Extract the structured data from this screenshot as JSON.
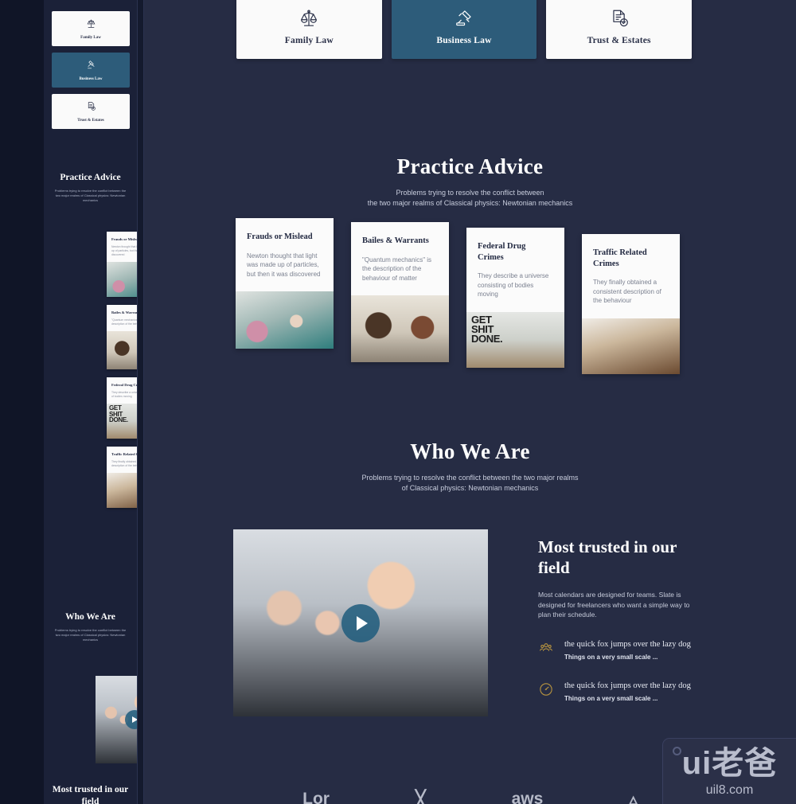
{
  "theme": {
    "background": "#262c44",
    "sidebar_background": "#1b2138",
    "gutter_background": "#101527",
    "accent_teal": "#2d5c7a",
    "card_background": "#fafafa",
    "icon_gold": "#b9953f"
  },
  "tabs": [
    {
      "label": "Family Law",
      "icon": "scales-of-justice-icon",
      "active": false
    },
    {
      "label": "Business Law",
      "icon": "gavel-icon",
      "active": true
    },
    {
      "label": "Trust & Estates",
      "icon": "document-check-icon",
      "active": false
    }
  ],
  "practice_advice": {
    "title": "Practice Advice",
    "subtitle_line1": "Problems trying to resolve the conflict between",
    "subtitle_line2": "the two major realms of Classical physics: Newtonian mechanics",
    "cards": [
      {
        "title": "Frauds or Mislead",
        "text": "Newton thought that light was made up of particles, but then it was discovered",
        "image": "woman-with-phone-at-desk-photo"
      },
      {
        "title": "Bailes & Warrants",
        "text": "\"Quantum mechanics\" is the description of the behaviour of matter",
        "image": "two-women-at-laptop-photo"
      },
      {
        "title": "Federal Drug Crimes",
        "text": "They describe a universe consisting of bodies moving",
        "image": "desk-with-get-shit-done-poster-photo",
        "image_text": "GET\nSHIT\nDONE."
      },
      {
        "title": "Traffic Related Crimes",
        "text": "They finally obtained a consistent description of the behaviour",
        "image": "desk-with-tablet-and-chair-photo"
      }
    ]
  },
  "who_we_are": {
    "title": "Who We Are",
    "subtitle_line1": "Problems trying to resolve the conflict between the two major realms",
    "subtitle_line2": "of Classical physics: Newtonian mechanics",
    "video": {
      "image": "businessman-with-team-photo",
      "play_button": "play-icon"
    },
    "heading": "Most trusted in our field",
    "body": "Most calendars are designed for teams. Slate is designed for freelancers who want a simple way to plan their schedule.",
    "features": [
      {
        "icon": "people-group-icon",
        "headline": "the quick fox jumps over the lazy dog",
        "subtext": "Things on a very small scale ..."
      },
      {
        "icon": "speedometer-icon",
        "headline": "the quick fox jumps over the lazy dog",
        "subtext": "Things on a very small scale ..."
      }
    ]
  },
  "footer_logos": [
    {
      "label": "Lor",
      "icon": "logo-mark-1"
    },
    {
      "label": "",
      "icon": "logo-mark-2"
    },
    {
      "label": "aws",
      "icon": "aws-logo"
    },
    {
      "label": "",
      "icon": "logo-mark-4"
    }
  ],
  "watermark": {
    "main": "ui老爸",
    "sub": "uil8.com",
    "dot": "circle-icon"
  }
}
